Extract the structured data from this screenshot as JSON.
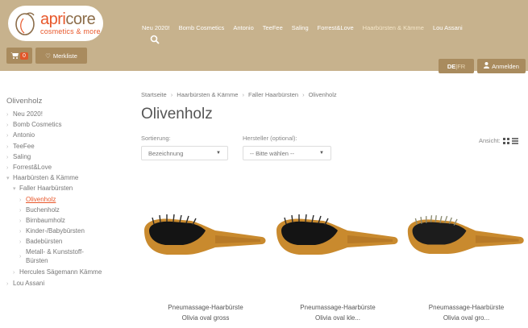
{
  "brand": {
    "name_a": "apri",
    "name_b": "core",
    "tagline": "cosmetics & more"
  },
  "topnav": [
    "Neu 2020!",
    "Bomb Cosmetics",
    "Antonio",
    "TeeFee",
    "Saling",
    "Forrest&Love",
    "Haarbürsten & Kämme",
    "Lou Assani"
  ],
  "topnav_active_index": 6,
  "cart": {
    "count": "0"
  },
  "merkliste_label": "Merkliste",
  "lang": {
    "de": "DE",
    "sep": " | ",
    "fr": "FR"
  },
  "login_label": "Anmelden",
  "sidebar": {
    "title": "Olivenholz",
    "items": [
      {
        "label": "Neu 2020!"
      },
      {
        "label": "Bomb Cosmetics"
      },
      {
        "label": "Antonio"
      },
      {
        "label": "TeeFee"
      },
      {
        "label": "Saling"
      },
      {
        "label": "Forrest&Love"
      },
      {
        "label": "Haarbürsten & Kämme"
      },
      {
        "label": "Faller Haarbürsten"
      },
      {
        "label": "Olivenholz"
      },
      {
        "label": "Buchenholz"
      },
      {
        "label": "Birnbaumholz"
      },
      {
        "label": "Kinder-/Babybürsten"
      },
      {
        "label": "Badebürsten"
      },
      {
        "label": "Metall- & Kunststoff-Bürsten"
      },
      {
        "label": "Hercules Sägemann Kämme"
      },
      {
        "label": "Lou Assani"
      }
    ]
  },
  "breadcrumb": [
    "Startseite",
    "Haarbürsten & Kämme",
    "Faller Haarbürsten",
    "Olivenholz"
  ],
  "page_title": "Olivenholz",
  "sort": {
    "label": "Sortierung:",
    "value": "Bezeichnung"
  },
  "maker": {
    "label": "Hersteller (optional):",
    "value": "-- Bitte wählen --"
  },
  "view_label": "Ansicht:",
  "products": [
    {
      "line1": "Pneumassage-Haarbürste",
      "line2": "Olivia oval gross"
    },
    {
      "line1": "Pneumassage-Haarbürste",
      "line2": "Olivia oval kle..."
    },
    {
      "line1": "Pneumassage-Haarbürste",
      "line2": "Olivia oval gro..."
    }
  ],
  "colors": {
    "header_bg": "#c7b28d",
    "accent": "#e8572a",
    "button_bg": "#a98b5e"
  }
}
